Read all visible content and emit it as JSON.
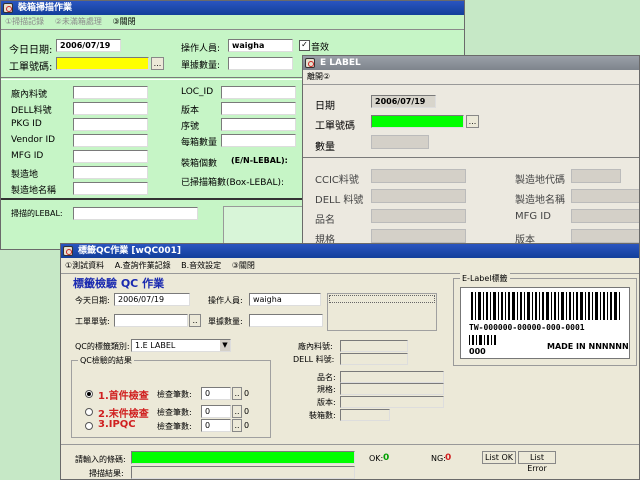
{
  "win1": {
    "title": "裝箱掃描作業",
    "menu": [
      "①掃描記錄",
      "②未滿箱處理",
      "③關閉"
    ],
    "date_label": "今日日期:",
    "date_value": "2006/07/19",
    "operator_label": "操作人員:",
    "operator_value": "waigha",
    "sound_label": "音效",
    "order_label": "工單號碼:",
    "qty_label": "單據數量:",
    "fields_left": [
      "廠內料號",
      "DELL料號",
      "PKG ID",
      "Vendor ID",
      "MFG ID",
      "製造地",
      "製造地名稱"
    ],
    "fields_right": [
      "LOC_ID",
      "版本",
      "序號",
      "每箱數量"
    ],
    "pack_label": "裝箱個數",
    "pack_suffix": "(E/N-LEBAL):",
    "scanned_label": "已掃描箱數(Box-LEBAL):",
    "scan_label": "掃描的LEBAL:"
  },
  "win2": {
    "title": "E LABEL",
    "menu": "離開②",
    "date_label": "日期",
    "date_value": "2006/07/19",
    "order_label": "工單號碼",
    "qty_label": "數量",
    "left_fields": [
      "CCIC料號",
      "DELL 料號",
      "品名",
      "規格"
    ],
    "right_fields": [
      "製造地代碼",
      "製造地名稱",
      "MFG ID",
      "版本"
    ]
  },
  "win3": {
    "title": "標籤QC作業 [wQC001]",
    "menu": [
      "①測試資料",
      "A.查詢作業記錄",
      "B.音效設定",
      "③關閉"
    ],
    "heading": "標籤檢驗 QC 作業",
    "date_label": "今天日期:",
    "date_value": "2006/07/19",
    "operator_label": "操作人員:",
    "operator_value": "waigha",
    "order_label": "工單單號:",
    "qty_label": "單據數量:",
    "qc_type_label": "QC的標籤類別:",
    "qc_type_value": "1.E   LABEL",
    "group_label": "QC檢驗的結果",
    "radios": [
      {
        "label": "1.首件檢查",
        "count_label": "檢查筆數:",
        "count": "0",
        "extra": "0"
      },
      {
        "label": "2.末件檢查",
        "count_label": "檢查筆數:",
        "count": "0",
        "extra": "0"
      },
      {
        "label": "3.IPQC",
        "count_label": "檢查筆數:",
        "count": "0",
        "extra": "0"
      }
    ],
    "info_labels": [
      "廠內料號:",
      "DELL 料號:",
      "品名:",
      "規格:",
      "版本:",
      "裝箱數:"
    ],
    "elabel_caption": "E-Label標籤",
    "barcode_text": "TW-000000-00000-000-0001",
    "barcode_qty": "000",
    "made_in": "MADE IN NNNNNN",
    "input_label": "請輸入的條碼:",
    "result_label": "掃描結果:",
    "ok_label": "OK:",
    "ok_value": "0",
    "ng_label": "NG:",
    "ng_value": "0",
    "list_ok": "List OK",
    "list_error": "List Error"
  },
  "colors": {
    "green_bg": "#c6f5c6",
    "yellow_field": "#ffff00",
    "bright_green": "#00ff00",
    "heading_blue": "#1a2ab0",
    "radio_red": "#d02020"
  }
}
